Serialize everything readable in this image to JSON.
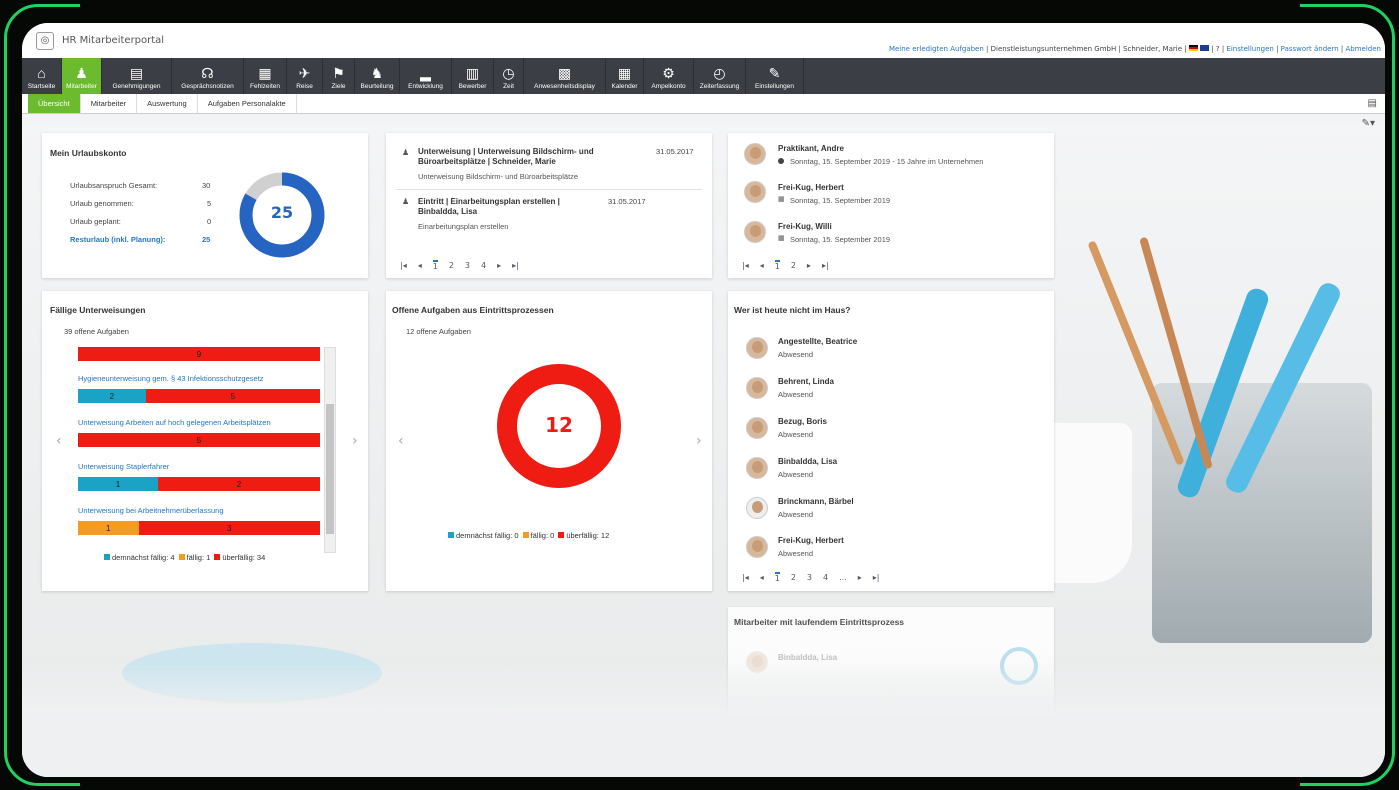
{
  "app": {
    "title": "HR Mitarbeiterportal"
  },
  "toplinks": {
    "tasks": "Meine erledigten Aufgaben",
    "company": "Dienstleistungsunternehmen GmbH",
    "user": "Schneider, Marie",
    "settings": "Einstellungen",
    "password": "Passwort ändern",
    "logout": "Abmelden"
  },
  "nav": [
    "Startseite",
    "Mitarbeiter",
    "Genehmigungen",
    "Gesprächsnotizen",
    "Fehlzeiten",
    "Reise",
    "Ziele",
    "Beurteilung",
    "Entwicklung",
    "Bewerber",
    "Zeit",
    "Anwesenheitsdisplay",
    "Kalender",
    "Ampelkonto",
    "Zeiterfassung",
    "Einstellungen"
  ],
  "subtabs": [
    "Übersicht",
    "Mitarbeiter",
    "Auswertung",
    "Aufgaben Personalakte"
  ],
  "urlaub": {
    "title": "Mein Urlaubskonto",
    "rows": [
      {
        "label": "Urlaubsanspruch Gesamt:",
        "value": "30"
      },
      {
        "label": "Urlaub genommen:",
        "value": "5"
      },
      {
        "label": "Urlaub geplant:",
        "value": "0"
      }
    ],
    "rest_label": "Resturlaub (inkl. Planung):",
    "rest_value": "25",
    "donut_value": "25"
  },
  "tasks": {
    "items": [
      {
        "title": "Unterweisung | Unterweisung Bildschirm- und Büroarbeitsplätze | Schneider, Marie",
        "date": "31.05.2017",
        "sub": "Unterweisung Bildschirm- und Büroarbeitsplätze"
      },
      {
        "title": "Eintritt | Einarbeitungsplan erstellen | Binbaldda, Lisa",
        "date": "31.05.2017",
        "sub": "Einarbeitungsplan erstellen"
      }
    ],
    "pages": [
      "1",
      "2",
      "3",
      "4"
    ]
  },
  "birthdays": {
    "items": [
      {
        "name": "Praktikant, Andre",
        "sub": "Sonntag, 15. September 2019 - 15 Jahre im Unternehmen"
      },
      {
        "name": "Frei-Kug, Herbert",
        "sub": "Sonntag, 15. September 2019"
      },
      {
        "name": "Frei-Kug, Willi",
        "sub": "Sonntag, 15. September 2019"
      }
    ],
    "pages": [
      "1",
      "2"
    ]
  },
  "faellig": {
    "title": "Fällige Unterweisungen",
    "count": "39 offene Aufgaben",
    "first_bar": "9",
    "items": [
      {
        "label": "Hygieneunterweisung gem. § 43 Infektionsschutzgesetz",
        "a": "2",
        "b": "5"
      },
      {
        "label": "Unterweisung Arbeiten auf hoch gelegenen Arbeitsplätzen",
        "b": "5"
      },
      {
        "label": "Unterweisung Staplerfahrer",
        "a": "1",
        "b": "2"
      },
      {
        "label": "Unterweisung bei Arbeitnehmerüberlassung",
        "o": "1",
        "b": "3"
      }
    ],
    "legend": {
      "soon": "demnächst fällig: 4",
      "due": "fällig: 1",
      "over": "überfällig: 34"
    }
  },
  "offene": {
    "title": "Offene Aufgaben aus Eintrittsprozessen",
    "count": "12 offene Aufgaben",
    "donut_value": "12",
    "legend": {
      "soon": "demnächst fällig: 0",
      "due": "fällig: 0",
      "over": "überfällig: 12"
    }
  },
  "absent": {
    "title": "Wer ist heute nicht im Haus?",
    "items": [
      {
        "name": "Angestellte, Beatrice",
        "sub": "Abwesend"
      },
      {
        "name": "Behrent, Linda",
        "sub": "Abwesend"
      },
      {
        "name": "Bezug, Boris",
        "sub": "Abwesend"
      },
      {
        "name": "Binbaldda, Lisa",
        "sub": "Abwesend"
      },
      {
        "name": "Brinckmann, Bärbel",
        "sub": "Abwesend"
      },
      {
        "name": "Frei-Kug, Herbert",
        "sub": "Abwesend"
      }
    ],
    "pages": [
      "1",
      "2",
      "3",
      "4",
      "..."
    ]
  },
  "eintritt": {
    "title": "Mitarbeiter mit laufendem Eintrittsprozess",
    "first": "Binbaldda, Lisa"
  },
  "colors": {
    "green": "#6cbb2f",
    "blue": "#2677c2",
    "red": "#ee1c12",
    "teal": "#1aa3c4",
    "orange": "#f49b21"
  }
}
